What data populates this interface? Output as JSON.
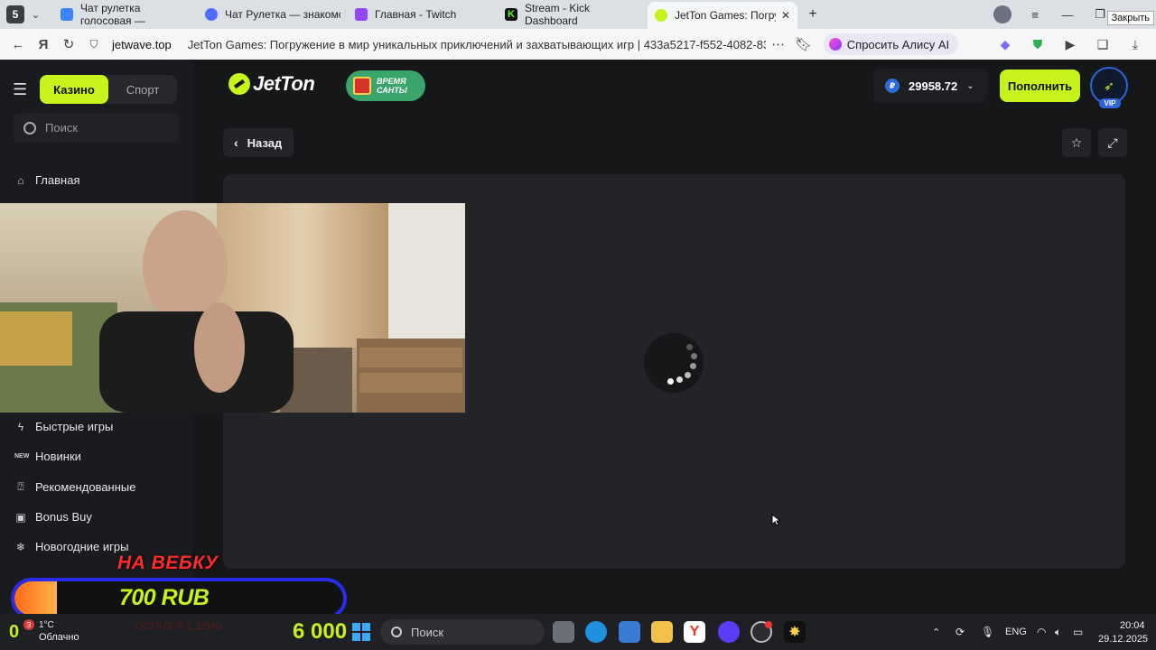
{
  "browser": {
    "tab_count": "5",
    "tabs": [
      {
        "title": "Чат рулетка голосовая —",
        "color": "#3b82f6"
      },
      {
        "title": "Чат Рулетка — знакомств",
        "color": "#4f6cff"
      },
      {
        "title": "Главная - Twitch",
        "color": "#9146ff"
      },
      {
        "title": "Stream - Kick Dashboard",
        "color": "#53fc18"
      },
      {
        "title": "JetTon Games: Погруже",
        "color": "#c6f31c"
      }
    ],
    "close_tooltip": "Закрыть",
    "domain": "jetwave.top",
    "page_title": "JetTon Games: Погружение в мир уникальных приключений и захватывающих игр | 433a5217-f552-4082-83...",
    "alice_label": "Спросить Алису AI"
  },
  "sidebar": {
    "mode_casino": "Казино",
    "mode_sport": "Спорт",
    "search_placeholder": "Поиск",
    "items": [
      {
        "label": "Главная",
        "icon": "home-icon"
      },
      {
        "label": "Быстрые игры",
        "icon": "lightning-icon"
      },
      {
        "label": "Новинки",
        "icon": "new-icon"
      },
      {
        "label": "Рекомендованные",
        "icon": "badge-icon"
      },
      {
        "label": "Bonus Buy",
        "icon": "bag-icon"
      },
      {
        "label": "Новогодние игры",
        "icon": "snowflake-icon"
      }
    ]
  },
  "header": {
    "logo_text": "JetTon",
    "promo_line1": "Время",
    "promo_line2": "Санты",
    "currency_symbol": "₽",
    "balance": "29958.72",
    "deposit_label": "Пополнить",
    "vip_label": "VIP"
  },
  "game": {
    "back_label": "Назад"
  },
  "overlay": {
    "donate_title": "НА ВЕБКУ",
    "donate_amount": "700 RUB",
    "donate_progress": 0.13,
    "donate_sub": "ОСТАЛСЯ 1 ДЕНЬ",
    "counter_left": "0",
    "counter_big": "6 000"
  },
  "taskbar": {
    "notif_badge": "3",
    "weather_temp": "1°C",
    "weather_desc": "Облачно",
    "search_label": "Поиск",
    "lang": "ENG",
    "time": "20:04",
    "date": "29.12.2025"
  },
  "colors": {
    "accent": "#c6f31c",
    "bg": "#151719",
    "panel": "#222427"
  }
}
